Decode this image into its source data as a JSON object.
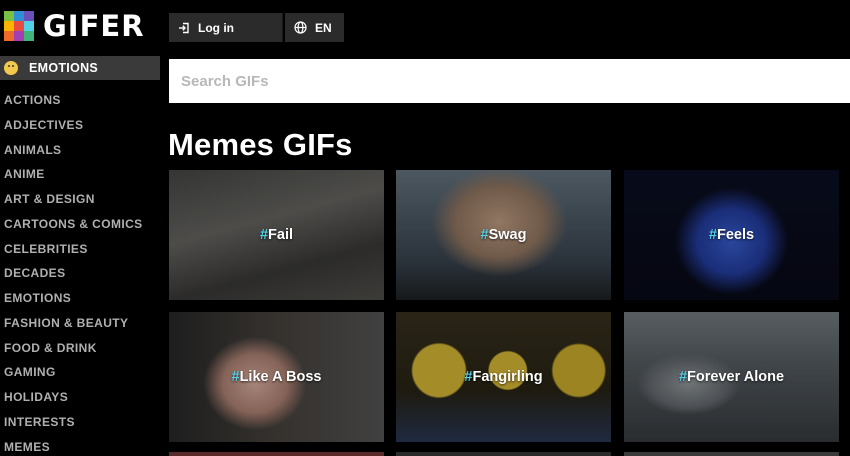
{
  "brand": {
    "name": "GIFER",
    "logo_colors": [
      "#7ac143",
      "#2e8fd6",
      "#6b4fbb",
      "#f7b500",
      "#e94b3c",
      "#4fd1e8",
      "#ee6a2a",
      "#a43fb3",
      "#3fb57a"
    ]
  },
  "topbar": {
    "login_label": "Log in",
    "lang_label": "EN"
  },
  "sidebar": {
    "active": "EMOTIONS",
    "items": [
      "ACTIONS",
      "ADJECTIVES",
      "ANIMALS",
      "ANIME",
      "ART & DESIGN",
      "CARTOONS & COMICS",
      "CELEBRITIES",
      "DECADES",
      "EMOTIONS",
      "FASHION & BEAUTY",
      "FOOD & DRINK",
      "GAMING",
      "HOLIDAYS",
      "INTERESTS",
      "MEMES"
    ]
  },
  "search": {
    "placeholder": "Search GIFs",
    "value": ""
  },
  "page": {
    "title": "Memes GIFs"
  },
  "tiles": [
    {
      "hash": "#",
      "tag": "Fail"
    },
    {
      "hash": "#",
      "tag": "Swag"
    },
    {
      "hash": "#",
      "tag": "Feels"
    },
    {
      "hash": "#",
      "tag": "Like A Boss"
    },
    {
      "hash": "#",
      "tag": "Fangirling"
    },
    {
      "hash": "#",
      "tag": "Forever Alone"
    }
  ],
  "colors": {
    "background": "#000000",
    "hashtag_accent": "#4fd1e8",
    "sidebar_active_bg": "#3a3a3a",
    "button_bg": "#2b2b2b"
  }
}
